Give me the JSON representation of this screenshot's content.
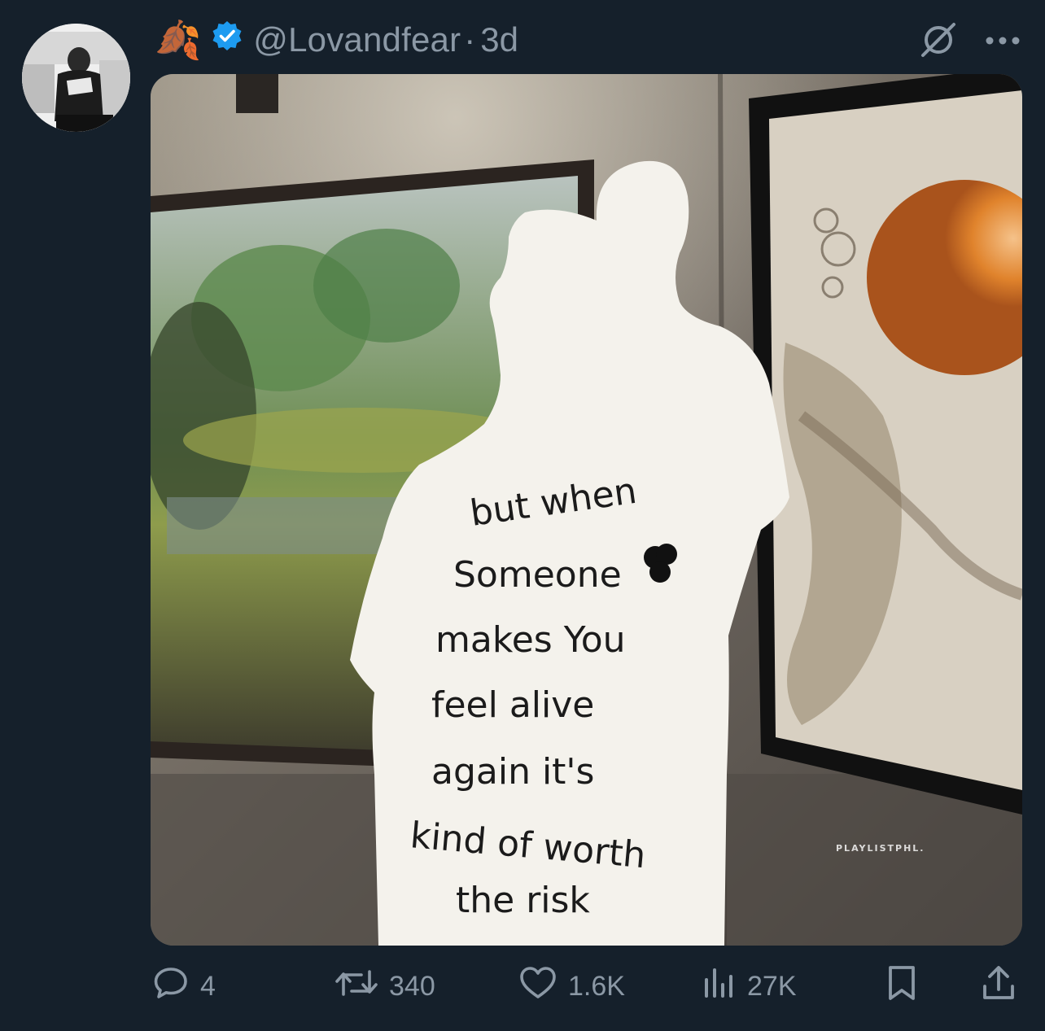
{
  "tweet": {
    "author_emoji": "🍂",
    "verified": true,
    "handle": "@Lovandfear",
    "separator": "·",
    "age": "3d",
    "image": {
      "handwriting": [
        "but when",
        "Someone",
        "makes You",
        "feel alive",
        "again it's",
        "kind of worth",
        "the risk"
      ],
      "watermark": "PLAYLISTPHL."
    },
    "stats": {
      "replies": "4",
      "reposts": "340",
      "likes": "1.6K",
      "views": "27K"
    }
  },
  "icons": {
    "verified": "verified-badge-icon",
    "grok": "slashed-circle-icon",
    "more": "more-dots-icon",
    "reply": "reply-bubble-icon",
    "repost": "repost-icon",
    "like": "heart-icon",
    "views": "bar-chart-icon",
    "bookmark": "bookmark-icon",
    "share": "share-upload-icon"
  },
  "colors": {
    "background": "#15202b",
    "muted_text": "#8b98a5",
    "verified_blue": "#1d9bf0"
  }
}
